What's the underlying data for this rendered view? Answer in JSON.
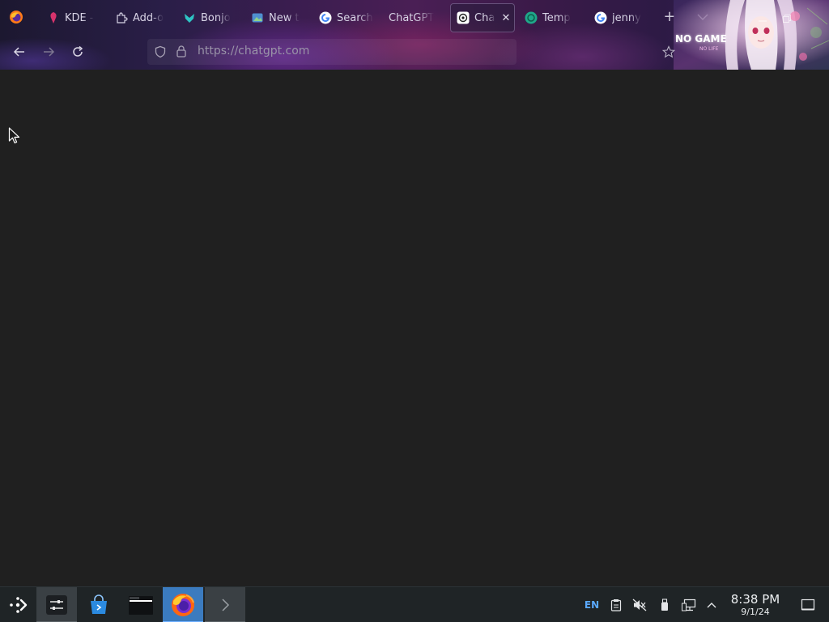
{
  "browser": {
    "tabs": [
      {
        "label": "KDE - ",
        "icon": "kde-icon",
        "active": false
      },
      {
        "label": "Add-o",
        "icon": "puzzle-icon",
        "active": false
      },
      {
        "label": "Bonjo",
        "icon": "bonjour-icon",
        "active": false
      },
      {
        "label": "New t",
        "icon": "new-tab-icon",
        "active": false
      },
      {
        "label": "Search",
        "icon": "google-icon",
        "active": false
      },
      {
        "label": "ChatGPT",
        "icon": "",
        "active": false
      },
      {
        "label": "Cha",
        "icon": "openai-icon",
        "active": true
      },
      {
        "label": "Temp",
        "icon": "temp-icon",
        "active": false
      },
      {
        "label": "jenny",
        "icon": "google-icon",
        "active": false
      }
    ],
    "new_tab_label": "+",
    "tab_list_label": "⌄",
    "close_tab_label": "✕",
    "url": "https://chatgpt.com",
    "banner": {
      "title": "NO GAME",
      "subtitle": "NO LIFE"
    }
  },
  "taskbar": {
    "apps": [
      {
        "name": "application-launcher",
        "icon": "kde-launcher-icon"
      },
      {
        "name": "system-settings",
        "icon": "settings-sliders-icon"
      },
      {
        "name": "discover-store",
        "icon": "store-bag-icon"
      },
      {
        "name": "file-manager",
        "icon": "folder-icon"
      },
      {
        "name": "firefox",
        "icon": "firefox-icon"
      },
      {
        "name": "terminal",
        "icon": "terminal-chevron-icon"
      }
    ],
    "tray": {
      "language": "EN"
    },
    "clock": {
      "time": "8:38 PM",
      "date": "9/1/24"
    }
  },
  "colors": {
    "page_background": "#202020",
    "taskbar_background": "#1f2426",
    "focused_task": "#3b7bbf",
    "language_accent": "#5aa9ff"
  }
}
